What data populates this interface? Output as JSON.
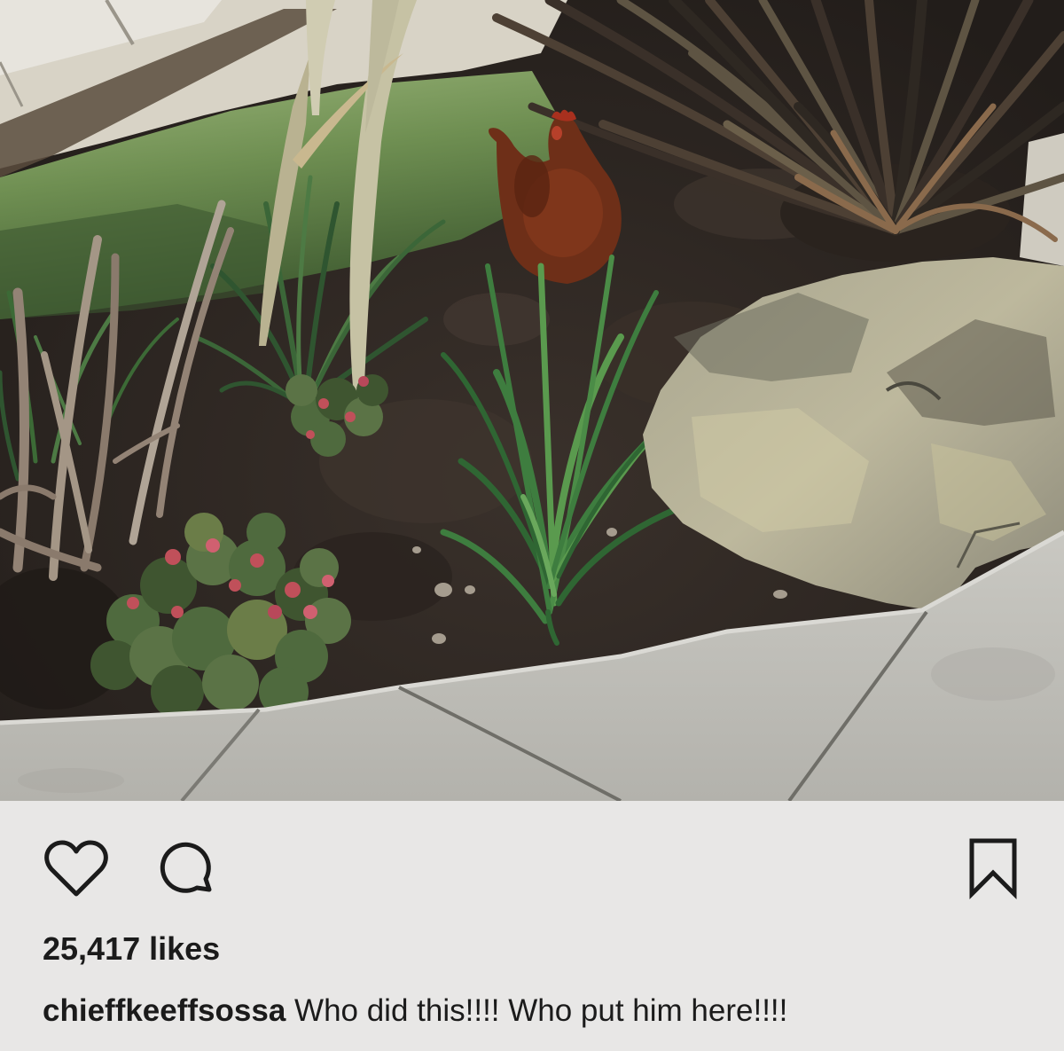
{
  "post": {
    "actions": {
      "like_icon": "heart-icon",
      "comment_icon": "comment-icon",
      "save_icon": "bookmark-icon"
    },
    "likes_text": "25,417 likes",
    "caption": {
      "username": "chieffkeeffsossa",
      "text": "Who did this!!!! Who put him here!!!!"
    }
  },
  "colors": {
    "action_bar_background": "#e8e7e6",
    "text": "#1b1b1b",
    "icon_stroke": "#1b1b1b"
  }
}
